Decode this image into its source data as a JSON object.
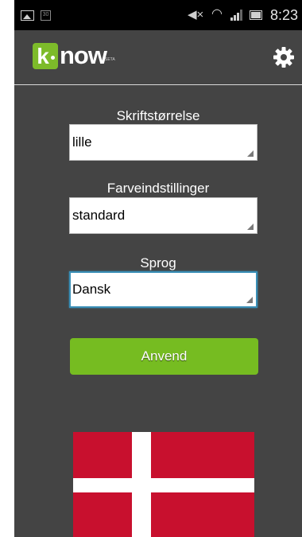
{
  "status_bar": {
    "time": "8:23",
    "icons": [
      "gallery-icon",
      "calendar-icon",
      "mute-icon",
      "wifi-icon",
      "signal-icon",
      "battery-icon"
    ]
  },
  "app_bar": {
    "logo_letter": "k",
    "logo_word": "now",
    "logo_subtext": "SETA",
    "settings_icon": "gear-icon"
  },
  "settings": {
    "font_size": {
      "label": "Skriftstørrelse",
      "value": "lille"
    },
    "color_settings": {
      "label": "Farveindstillinger",
      "value": "standard"
    },
    "language": {
      "label": "Sprog",
      "value": "Dansk"
    }
  },
  "apply_button": {
    "label": "Anvend"
  },
  "flag": {
    "name": "danish-flag",
    "colors": {
      "red": "#c8102e",
      "white": "#ffffff"
    }
  },
  "colors": {
    "accent": "#76bc21",
    "background": "#444444",
    "focus": "#3a8fb7"
  }
}
